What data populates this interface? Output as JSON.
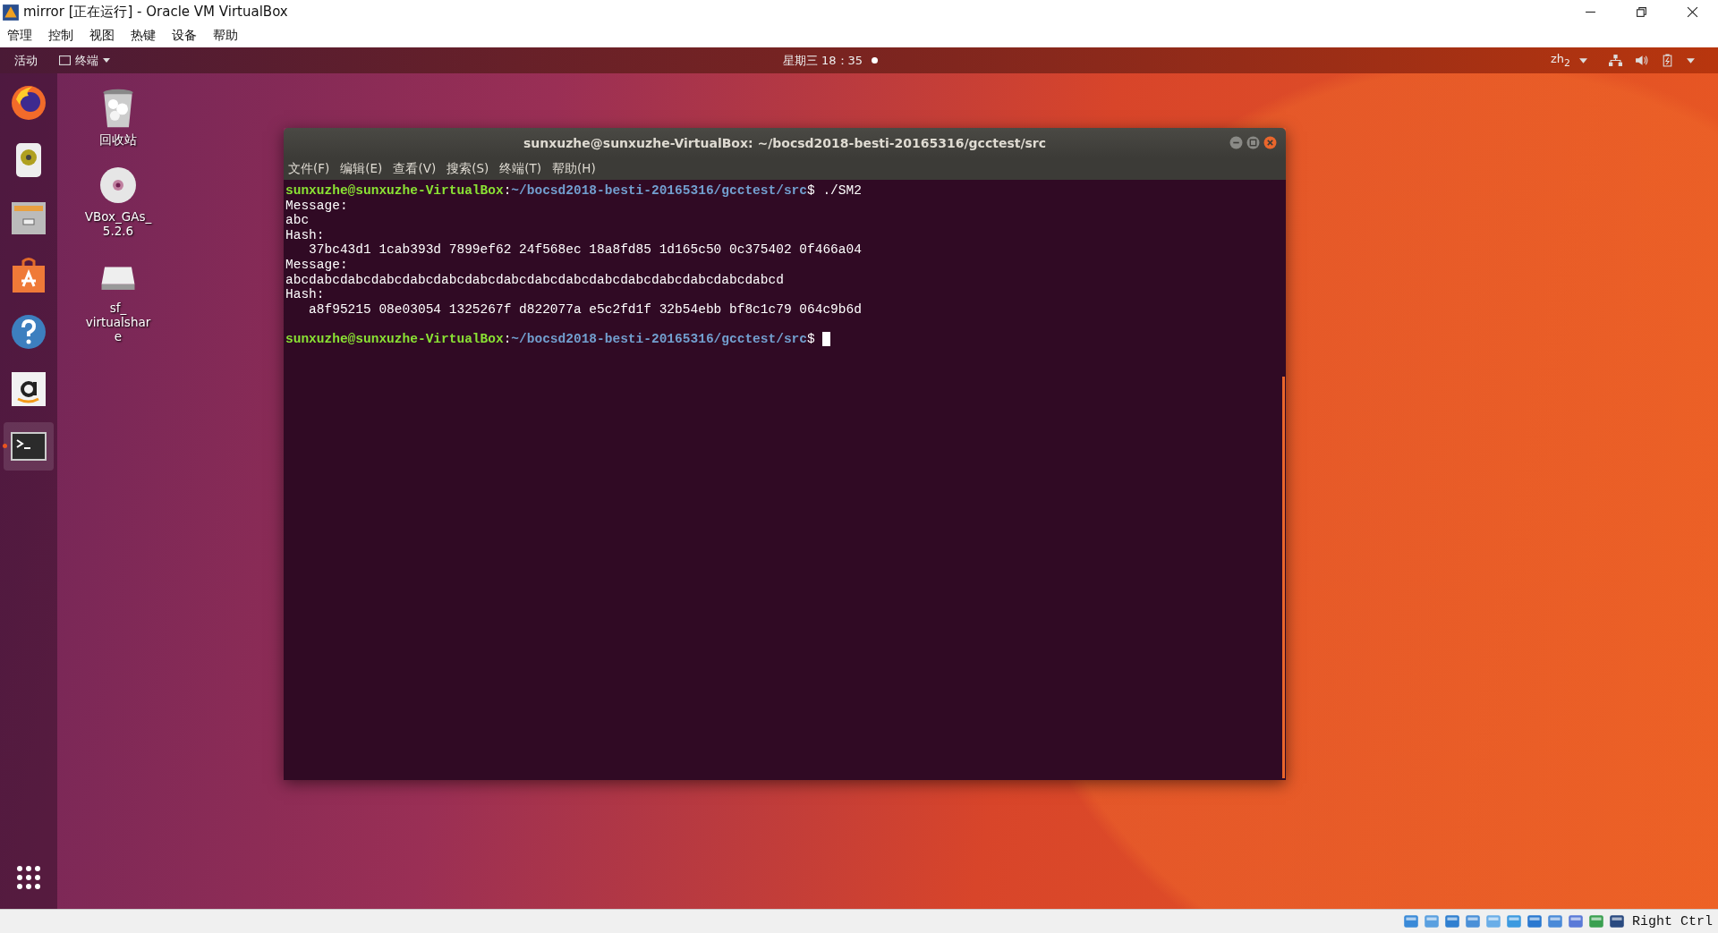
{
  "window": {
    "title": "mirror [正在运行] - Oracle VM VirtualBox"
  },
  "menu": [
    "管理",
    "控制",
    "视图",
    "热键",
    "设备",
    "帮助"
  ],
  "top_bar": {
    "activities": "活动",
    "app_menu": "终端",
    "clock": "星期三 18：35",
    "input_method": "zh$_{2}$"
  },
  "dock": [
    {
      "kind": "browser",
      "running": false
    },
    {
      "kind": "speaker",
      "running": false
    },
    {
      "kind": "files",
      "running": false
    },
    {
      "kind": "store",
      "running": false
    },
    {
      "kind": "help",
      "running": false
    },
    {
      "kind": "shop",
      "running": false
    },
    {
      "kind": "terminal",
      "running": true
    }
  ],
  "desktop_icons": [
    {
      "kind": "trash",
      "lines": [
        "回收站"
      ]
    },
    {
      "kind": "disc",
      "lines": [
        "VBox_GAs_",
        "5.2.6"
      ]
    },
    {
      "kind": "drive",
      "lines": [
        "sf_",
        "virtualshar",
        "e"
      ]
    }
  ],
  "terminal": {
    "title": "sunxuzhe@sunxuzhe-VirtualBox: ~/bocsd2018-besti-20165316/gcctest/src",
    "menu": [
      "文件(F)",
      "编辑(E)",
      "查看(V)",
      "搜索(S)",
      "终端(T)",
      "帮助(H)"
    ],
    "lines": [
      {
        "kind": "prompt",
        "user": "sunxuzhe@sunxuzhe-VirtualBox",
        "sep": ":",
        "path": "~/bocsd2018-besti-20165316/gcctest/src",
        "end": "$",
        "command": "./SM2",
        "cursor": false
      },
      {
        "kind": "output",
        "text": "Message:"
      },
      {
        "kind": "output",
        "text": "abc"
      },
      {
        "kind": "output",
        "text": "Hash:"
      },
      {
        "kind": "output",
        "text": "   37bc43d1 1cab393d 7899ef62 24f568ec 18a8fd85 1d165c50 0c375402 0f466a04"
      },
      {
        "kind": "output",
        "text": "Message:"
      },
      {
        "kind": "output",
        "text": "abcdabcdabcdabcdabcdabcdabcdabcdabcdabcdabcdabcdabcdabcdabcdabcd"
      },
      {
        "kind": "output",
        "text": "Hash:"
      },
      {
        "kind": "output",
        "text": "   a8f95215 08e03054 1325267f d822077a e5c2fd1f 32b54ebb bf8c1c79 064c9b6d"
      },
      {
        "kind": "blank"
      },
      {
        "kind": "prompt",
        "user": "sunxuzhe@sunxuzhe-VirtualBox",
        "sep": ":",
        "path": "~/bocsd2018-besti-20165316/gcctest/src",
        "end": "$",
        "cursor": true
      }
    ]
  },
  "status_bar": {
    "host_key": "Right Ctrl"
  }
}
